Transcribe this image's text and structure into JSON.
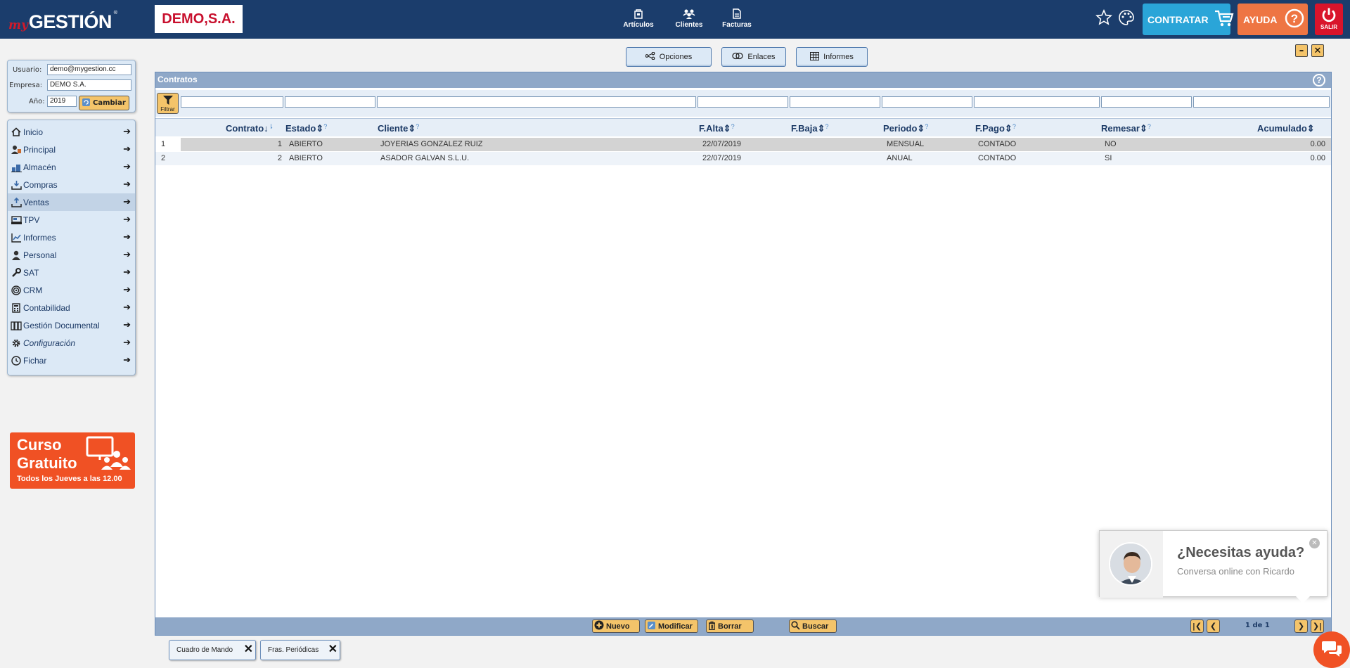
{
  "app": {
    "logo_my": "my",
    "logo_gestion": "GESTIÓN",
    "logo_reg": "®",
    "company_brand": "DEMO,S.A."
  },
  "topnav": [
    {
      "label": "Artículos",
      "icon": "articles-icon"
    },
    {
      "label": "Clientes",
      "icon": "clients-icon"
    },
    {
      "label": "Facturas",
      "icon": "invoices-icon"
    }
  ],
  "header": {
    "contratar_label": "CONTRATAR",
    "ayuda_label": "AYUDA",
    "salir_label": "SALIR"
  },
  "user_panel": {
    "usuario_label": "Usuario:",
    "usuario_value": "demo@mygestion.cc",
    "empresa_label": "Empresa:",
    "empresa_value": "DEMO S.A.",
    "anio_label": "Año:",
    "anio_value": "2019",
    "cambiar_label": "Cambiar"
  },
  "menu": [
    {
      "label": "Inicio",
      "icon": "home-icon"
    },
    {
      "label": "Principal",
      "icon": "principal-icon"
    },
    {
      "label": "Almacén",
      "icon": "warehouse-icon"
    },
    {
      "label": "Compras",
      "icon": "purchases-icon"
    },
    {
      "label": "Ventas",
      "icon": "sales-icon",
      "active": true
    },
    {
      "label": "TPV",
      "icon": "pos-icon"
    },
    {
      "label": "Informes",
      "icon": "reports-icon"
    },
    {
      "label": "Personal",
      "icon": "personnel-icon"
    },
    {
      "label": "SAT",
      "icon": "wrench-icon"
    },
    {
      "label": "CRM",
      "icon": "crm-icon"
    },
    {
      "label": "Contabilidad",
      "icon": "calculator-icon"
    },
    {
      "label": "Gestión Documental",
      "icon": "documents-icon"
    },
    {
      "label": "Configuración",
      "icon": "gear-icon"
    },
    {
      "label": "Fichar",
      "icon": "clock-icon"
    }
  ],
  "promo": {
    "line1": "Curso",
    "line2": "Gratuito",
    "line3": "Todos los Jueves a las 12.00"
  },
  "toolbar": {
    "opciones_label": "Opciones",
    "enlaces_label": "Enlaces",
    "informes_label": "Informes"
  },
  "panel": {
    "title": "Contratos",
    "filter_label": "Filtrar"
  },
  "table": {
    "columns": [
      "Contrato",
      "Estado",
      "Cliente",
      "F.Alta",
      "F.Baja",
      "Periodo",
      "F.Pago",
      "Remesar",
      "Acumulado"
    ],
    "rows": [
      {
        "n": "1",
        "contrato": "1",
        "estado": "ABIERTO",
        "cliente": "JOYERIAS GONZALEZ RUIZ",
        "falta": "22/07/2019",
        "fbaja": "",
        "periodo": "MENSUAL",
        "fpago": "CONTADO",
        "remesar": "NO",
        "acumulado": "0.00"
      },
      {
        "n": "2",
        "contrato": "2",
        "estado": "ABIERTO",
        "cliente": "ASADOR GALVAN S.L.U.",
        "falta": "22/07/2019",
        "fbaja": "",
        "periodo": "ANUAL",
        "fpago": "CONTADO",
        "remesar": "SI",
        "acumulado": "0.00"
      }
    ]
  },
  "footer_actions": {
    "nuevo": "Nuevo",
    "modificar": "Modificar",
    "borrar": "Borrar",
    "buscar": "Buscar",
    "page_info": "1 de 1"
  },
  "bottom_tabs": [
    {
      "label": "Cuadro de Mando"
    },
    {
      "label": "Fras. Periódicas"
    }
  ],
  "chat": {
    "title": "¿Necesitas ayuda?",
    "subtitle": "Conversa online con Ricardo"
  },
  "colors": {
    "topbar": "#1b3d6c",
    "accent_yellow": "#f4c46a",
    "contratar": "#2aa5d8",
    "ayuda": "#ee7543",
    "salir": "#d9142b",
    "panel_header": "#8fa8c8",
    "promo": "#f05124"
  }
}
